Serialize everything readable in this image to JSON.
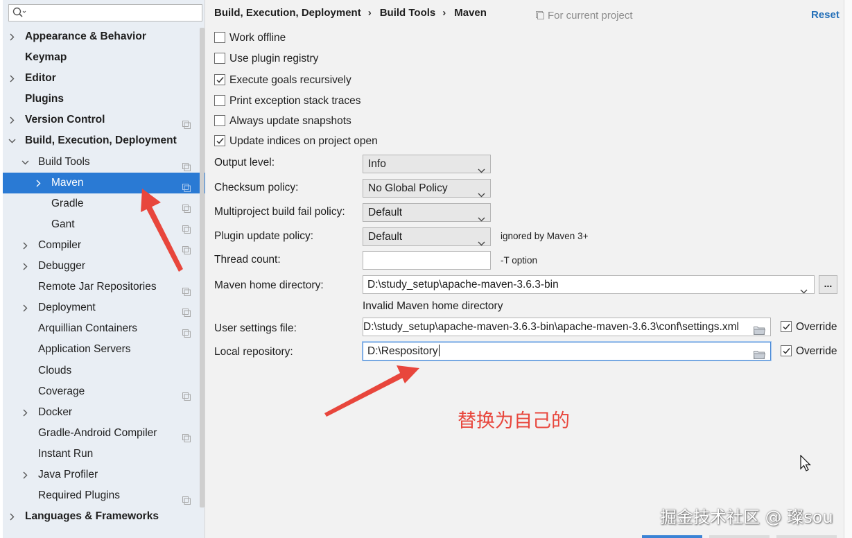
{
  "sidebar": {
    "search_placeholder": "",
    "items": [
      {
        "label": "Appearance & Behavior",
        "level": 0,
        "bold": true,
        "expander": "collapsed",
        "project_icon": false
      },
      {
        "label": "Keymap",
        "level": 0,
        "bold": true,
        "expander": "none",
        "project_icon": false
      },
      {
        "label": "Editor",
        "level": 0,
        "bold": true,
        "expander": "collapsed",
        "project_icon": false
      },
      {
        "label": "Plugins",
        "level": 0,
        "bold": true,
        "expander": "none",
        "project_icon": false
      },
      {
        "label": "Version Control",
        "level": 0,
        "bold": true,
        "expander": "collapsed",
        "project_icon": true
      },
      {
        "label": "Build, Execution, Deployment",
        "level": 0,
        "bold": true,
        "expander": "expanded",
        "project_icon": false
      },
      {
        "label": "Build Tools",
        "level": 1,
        "bold": false,
        "expander": "expanded",
        "project_icon": true
      },
      {
        "label": "Maven",
        "level": 2,
        "bold": false,
        "expander": "collapsed",
        "project_icon": true,
        "selected": true
      },
      {
        "label": "Gradle",
        "level": 2,
        "bold": false,
        "expander": "none",
        "project_icon": true
      },
      {
        "label": "Gant",
        "level": 2,
        "bold": false,
        "expander": "none",
        "project_icon": true
      },
      {
        "label": "Compiler",
        "level": 1,
        "bold": false,
        "expander": "collapsed",
        "project_icon": true
      },
      {
        "label": "Debugger",
        "level": 1,
        "bold": false,
        "expander": "collapsed",
        "project_icon": false
      },
      {
        "label": "Remote Jar Repositories",
        "level": 1,
        "bold": false,
        "expander": "none",
        "project_icon": true
      },
      {
        "label": "Deployment",
        "level": 1,
        "bold": false,
        "expander": "collapsed",
        "project_icon": true
      },
      {
        "label": "Arquillian Containers",
        "level": 1,
        "bold": false,
        "expander": "none",
        "project_icon": true
      },
      {
        "label": "Application Servers",
        "level": 1,
        "bold": false,
        "expander": "none",
        "project_icon": false
      },
      {
        "label": "Clouds",
        "level": 1,
        "bold": false,
        "expander": "none",
        "project_icon": false
      },
      {
        "label": "Coverage",
        "level": 1,
        "bold": false,
        "expander": "none",
        "project_icon": true
      },
      {
        "label": "Docker",
        "level": 1,
        "bold": false,
        "expander": "collapsed",
        "project_icon": false
      },
      {
        "label": "Gradle-Android Compiler",
        "level": 1,
        "bold": false,
        "expander": "none",
        "project_icon": true
      },
      {
        "label": "Instant Run",
        "level": 1,
        "bold": false,
        "expander": "none",
        "project_icon": false
      },
      {
        "label": "Java Profiler",
        "level": 1,
        "bold": false,
        "expander": "collapsed",
        "project_icon": false
      },
      {
        "label": "Required Plugins",
        "level": 1,
        "bold": false,
        "expander": "none",
        "project_icon": true
      },
      {
        "label": "Languages & Frameworks",
        "level": 0,
        "bold": true,
        "expander": "collapsed",
        "project_icon": false
      }
    ]
  },
  "header": {
    "breadcrumb": [
      "Build, Execution, Deployment",
      "Build Tools",
      "Maven"
    ],
    "breadcrumb_separator": "›",
    "for_current_project": "For current project",
    "reset_label": "Reset"
  },
  "checkboxes": [
    {
      "label": "Work offline",
      "checked": false
    },
    {
      "label": "Use plugin registry",
      "checked": false
    },
    {
      "label": "Execute goals recursively",
      "checked": true
    },
    {
      "label": "Print exception stack traces",
      "checked": false
    },
    {
      "label": "Always update snapshots",
      "checked": false
    },
    {
      "label": "Update indices on project open",
      "checked": true
    }
  ],
  "form": {
    "output_level": {
      "label": "Output level:",
      "value": "Info"
    },
    "checksum_policy": {
      "label": "Checksum policy:",
      "value": "No Global Policy"
    },
    "multiproject_fail_policy": {
      "label": "Multiproject build fail policy:",
      "value": "Default"
    },
    "plugin_update_policy": {
      "label": "Plugin update policy:",
      "value": "Default",
      "hint": "ignored by Maven 3+"
    },
    "thread_count": {
      "label": "Thread count:",
      "value": "",
      "hint": "-T option"
    },
    "maven_home": {
      "label": "Maven home directory:",
      "value": "D:\\study_setup\\apache-maven-3.6.3-bin",
      "browse_label": "...",
      "error": "Invalid Maven home directory"
    },
    "user_settings": {
      "label": "User settings file:",
      "value": "D:\\study_setup\\apache-maven-3.6.3-bin\\apache-maven-3.6.3\\conf\\settings.xml",
      "override_label": "Override",
      "override_checked": true
    },
    "local_repository": {
      "label": "Local repository:",
      "value": "D:\\Respository",
      "override_label": "Override",
      "override_checked": true
    }
  },
  "annotation": {
    "text": "替换为自己的",
    "color": "#e8463c"
  },
  "watermark": "掘金技术社区 @ 璨sou",
  "colors": {
    "selection": "#2a7ad4",
    "link": "#2470b8",
    "sidebar_bg": "#e9eef4",
    "main_bg": "#f2f2f2"
  }
}
